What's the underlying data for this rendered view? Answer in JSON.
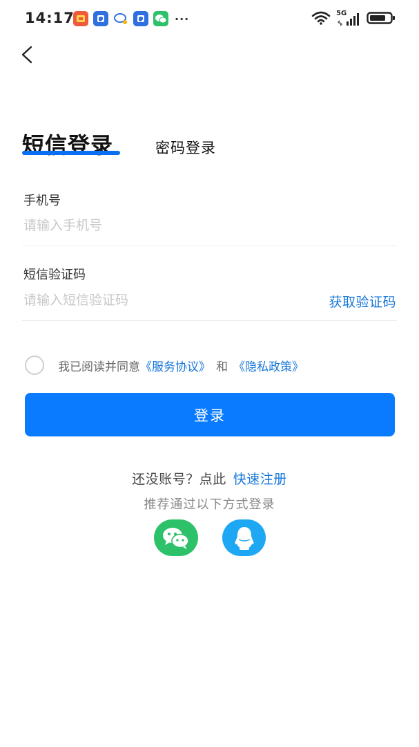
{
  "status_bar": {
    "time": "14:17",
    "more": "···",
    "network": "5G",
    "notification_icons": [
      "app-icon",
      "shield-app-icon",
      "chat-bubble-icon",
      "shield-app-icon",
      "wechat-icon"
    ]
  },
  "tabs": {
    "sms_login": "短信登录",
    "password_login": "密码登录"
  },
  "phone_field": {
    "label": "手机号",
    "placeholder": "请输入手机号",
    "value": ""
  },
  "code_field": {
    "label": "短信验证码",
    "placeholder": "请输入短信验证码",
    "value": "",
    "get_code": "获取验证码"
  },
  "agreement": {
    "prefix": "我已阅读并同意",
    "service_link": "《服务协议》",
    "conjunction": "和",
    "privacy_link": "《隐私政策》",
    "checked": false
  },
  "login_button": "登录",
  "register": {
    "prompt": "还没账号？点此",
    "link": "快速注册"
  },
  "third_party": {
    "hint": "推荐通过以下方式登录",
    "options": [
      "wechat-icon",
      "qq-icon"
    ]
  },
  "colors": {
    "accent": "#0a7bff",
    "link": "#1677d8",
    "wechat": "#2dc169",
    "qq": "#1ea8f3"
  }
}
